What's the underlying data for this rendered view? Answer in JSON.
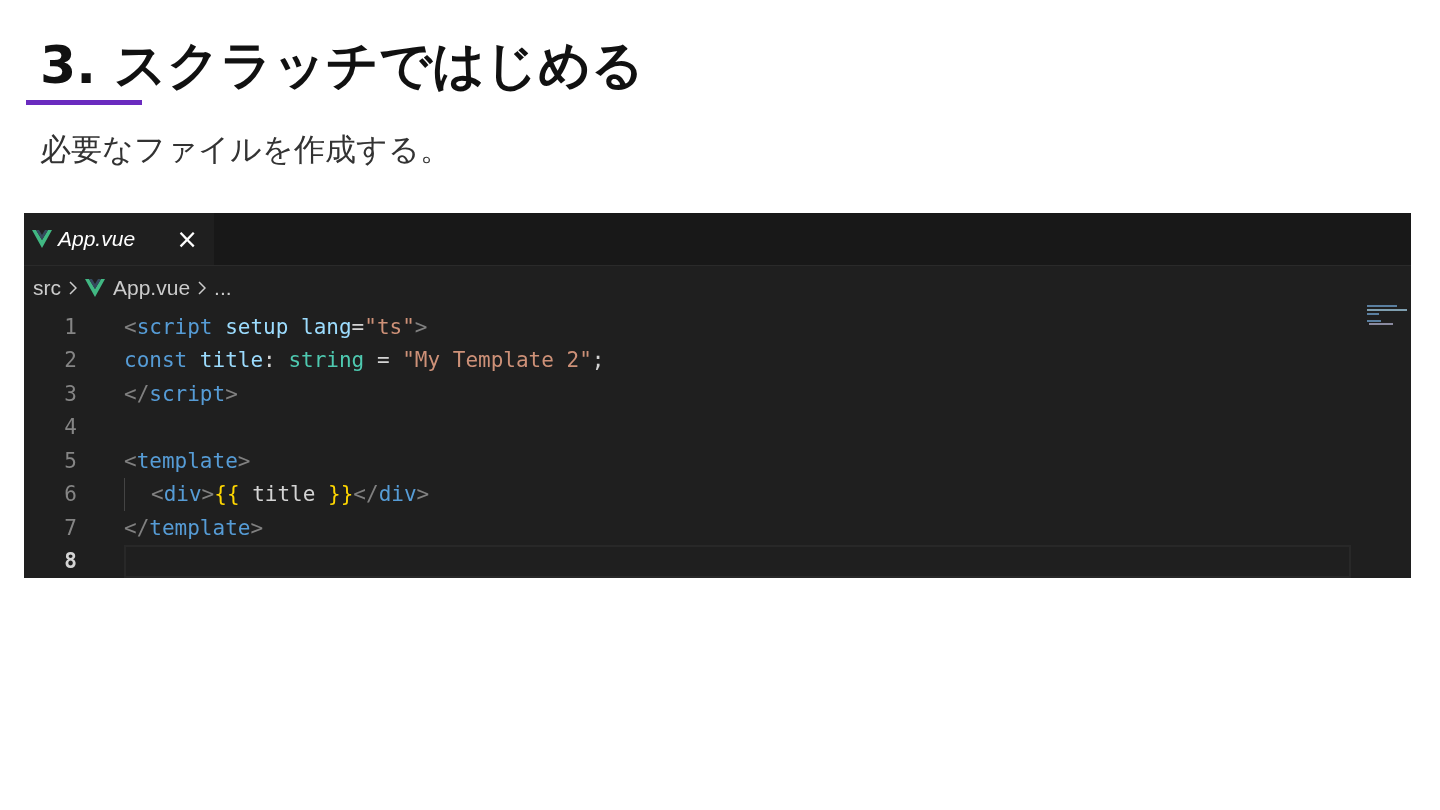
{
  "slide": {
    "title": "3. スクラッチではじめる",
    "subtitle": "必要なファイルを作成する。"
  },
  "editor": {
    "tabs": [
      {
        "label": "App.vue",
        "selected": true,
        "close": "×"
      }
    ],
    "breadcrumbs": [
      {
        "label": "src",
        "file": false
      },
      {
        "label": "App.vue",
        "file": true
      },
      {
        "label": "...",
        "file": false
      }
    ],
    "lines": [
      {
        "number": "1",
        "current": false,
        "indent_guide": false,
        "tokens": [
          {
            "text": "<",
            "kind": "punct"
          },
          {
            "text": "script",
            "kind": "tag"
          },
          {
            "text": " setup",
            "kind": "attr"
          },
          {
            "text": " lang",
            "kind": "attr"
          },
          {
            "text": "=",
            "kind": "plain"
          },
          {
            "text": "\"ts\"",
            "kind": "string"
          },
          {
            "text": ">",
            "kind": "punct"
          }
        ]
      },
      {
        "number": "2",
        "current": false,
        "indent_guide": false,
        "tokens": [
          {
            "text": "const",
            "kind": "keyword"
          },
          {
            "text": " title",
            "kind": "attr"
          },
          {
            "text": ": ",
            "kind": "plain"
          },
          {
            "text": "string",
            "kind": "type"
          },
          {
            "text": " = ",
            "kind": "plain"
          },
          {
            "text": "\"My Template 2\"",
            "kind": "string"
          },
          {
            "text": ";",
            "kind": "plain"
          }
        ]
      },
      {
        "number": "3",
        "current": false,
        "indent_guide": false,
        "tokens": [
          {
            "text": "</",
            "kind": "punct"
          },
          {
            "text": "script",
            "kind": "tag"
          },
          {
            "text": ">",
            "kind": "punct"
          }
        ]
      },
      {
        "number": "4",
        "current": false,
        "indent_guide": false
      },
      {
        "number": "5",
        "current": false,
        "indent_guide": false,
        "tokens": [
          {
            "text": "<",
            "kind": "punct"
          },
          {
            "text": "template",
            "kind": "tag"
          },
          {
            "text": ">",
            "kind": "punct"
          }
        ]
      },
      {
        "number": "6",
        "current": false,
        "indent_guide": true,
        "tokens": [
          {
            "text": "<",
            "kind": "punct"
          },
          {
            "text": "div",
            "kind": "tag"
          },
          {
            "text": ">",
            "kind": "punct"
          },
          {
            "text": "{{",
            "kind": "brace"
          },
          {
            "text": " title ",
            "kind": "plain"
          },
          {
            "text": "}}",
            "kind": "brace"
          },
          {
            "text": "</",
            "kind": "punct"
          },
          {
            "text": "div",
            "kind": "tag"
          },
          {
            "text": ">",
            "kind": "punct"
          }
        ]
      },
      {
        "number": "7",
        "current": false,
        "indent_guide": false,
        "tokens": [
          {
            "text": "</",
            "kind": "punct"
          },
          {
            "text": "template",
            "kind": "tag"
          },
          {
            "text": ">",
            "kind": "punct"
          }
        ]
      },
      {
        "number": "8",
        "current": true,
        "indent_guide": false
      }
    ]
  }
}
